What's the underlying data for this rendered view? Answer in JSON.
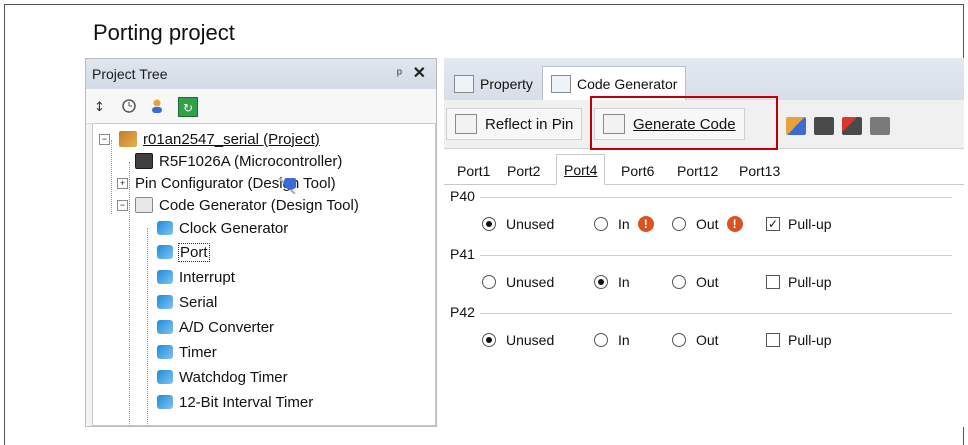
{
  "slide": {
    "title": "Porting project"
  },
  "left_panel": {
    "title": "Project Tree",
    "pin_glyph": "ᵖ",
    "close_glyph": "✕",
    "toolbar_icons": [
      "sort-icon",
      "clock-icon",
      "user-icon",
      "refresh-icon"
    ],
    "tree": [
      {
        "label": "r01an2547_serial (Project)",
        "icon": "project-icon",
        "expander": "−"
      },
      {
        "label": "R5F1026A (Microcontroller)",
        "icon": "microcontroller-icon"
      },
      {
        "label": "Pin Configurator (Design Tool)",
        "icon": "pin-configurator-icon",
        "expander": "+"
      },
      {
        "label": "Code Generator (Design Tool)",
        "icon": "code-generator-icon",
        "expander": "−"
      },
      {
        "label": "Clock Generator",
        "icon": "module-icon"
      },
      {
        "label": "Port",
        "icon": "module-icon"
      },
      {
        "label": "Interrupt",
        "icon": "module-icon"
      },
      {
        "label": "Serial",
        "icon": "module-icon"
      },
      {
        "label": "A/D Converter",
        "icon": "module-icon"
      },
      {
        "label": "Timer",
        "icon": "module-icon"
      },
      {
        "label": "Watchdog Timer",
        "icon": "module-icon"
      },
      {
        "label": "12-Bit Interval Timer",
        "icon": "module-icon"
      }
    ]
  },
  "right_panel": {
    "tabs": [
      {
        "label": "Property",
        "icon": "property-icon"
      },
      {
        "label": "Code Generator",
        "icon": "code-generator-icon",
        "active": true
      }
    ],
    "toolbar": {
      "reflect_label": "Reflect in Pin",
      "generate_label": "Generate Code",
      "extra_icons": [
        "group-icon",
        "chip-icon",
        "chip-arrow-icon",
        "chip-settings-icon"
      ]
    },
    "port_tabs": [
      "Port1",
      "Port2",
      "Port4",
      "Port6",
      "Port12",
      "Port13"
    ],
    "active_port_tab": "Port4",
    "pins": [
      {
        "name": "P40",
        "unused": "Unused",
        "in": "In",
        "out": "Out",
        "pullup": "Pull-up",
        "selected": "Unused",
        "pullup_checked": true,
        "warnings": true
      },
      {
        "name": "P41",
        "unused": "Unused",
        "in": "In",
        "out": "Out",
        "pullup": "Pull-up",
        "selected": "In",
        "pullup_checked": false,
        "warnings": false
      },
      {
        "name": "P42",
        "unused": "Unused",
        "in": "In",
        "out": "Out",
        "pullup": "Pull-up",
        "selected": "Unused",
        "pullup_checked": false,
        "warnings": false
      }
    ],
    "warning_glyph": "!",
    "check_glyph": "✓"
  },
  "colors": {
    "highlight": "#c00000",
    "warning": "#d9531e",
    "tab_bg": "#d7dee8"
  }
}
